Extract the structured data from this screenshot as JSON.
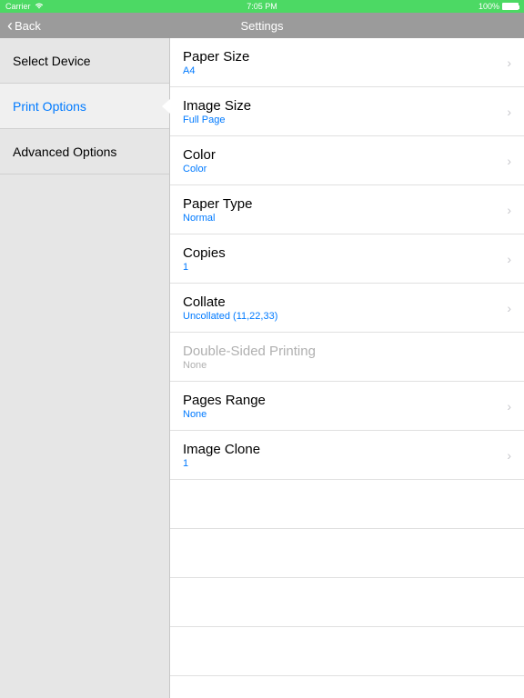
{
  "statusBar": {
    "carrier": "Carrier",
    "time": "7:05 PM",
    "battery": "100%"
  },
  "navBar": {
    "backLabel": "Back",
    "title": "Settings"
  },
  "sidebar": {
    "items": [
      {
        "label": "Select Device",
        "active": false
      },
      {
        "label": "Print Options",
        "active": true
      },
      {
        "label": "Advanced Options",
        "active": false
      }
    ]
  },
  "detail": {
    "items": [
      {
        "label": "Paper Size",
        "value": "A4",
        "disabled": false,
        "hasChevron": true,
        "name": "paper-size-row"
      },
      {
        "label": "Image Size",
        "value": "Full Page",
        "disabled": false,
        "hasChevron": true,
        "name": "image-size-row"
      },
      {
        "label": "Color",
        "value": "Color",
        "disabled": false,
        "hasChevron": true,
        "name": "color-row"
      },
      {
        "label": "Paper Type",
        "value": "Normal",
        "disabled": false,
        "hasChevron": true,
        "name": "paper-type-row"
      },
      {
        "label": "Copies",
        "value": "1",
        "disabled": false,
        "hasChevron": true,
        "name": "copies-row"
      },
      {
        "label": "Collate",
        "value": "Uncollated (11,22,33)",
        "disabled": false,
        "hasChevron": true,
        "name": "collate-row"
      },
      {
        "label": "Double-Sided Printing",
        "value": "None",
        "disabled": true,
        "hasChevron": false,
        "name": "double-sided-row"
      },
      {
        "label": "Pages Range",
        "value": "None",
        "disabled": false,
        "hasChevron": true,
        "name": "pages-range-row"
      },
      {
        "label": "Image Clone",
        "value": "1",
        "disabled": false,
        "hasChevron": true,
        "name": "image-clone-row"
      }
    ]
  }
}
